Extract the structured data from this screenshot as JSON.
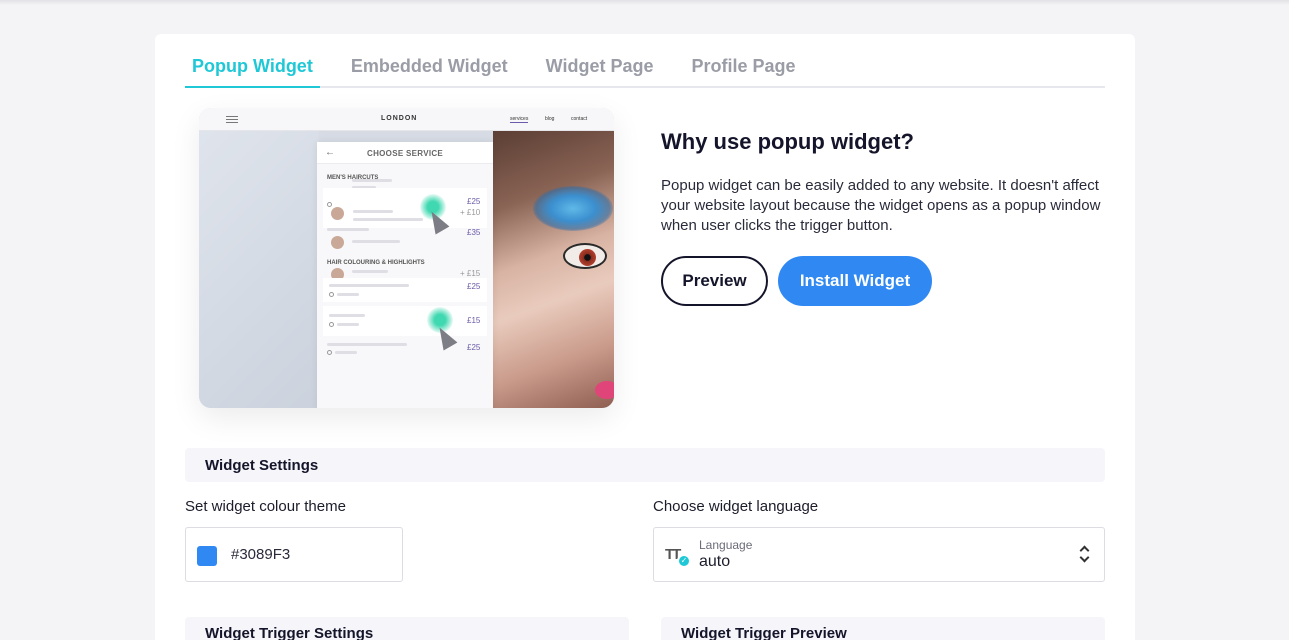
{
  "tabs": [
    "Popup Widget",
    "Embedded Widget",
    "Widget Page",
    "Profile Page"
  ],
  "preview": {
    "logo": "LONDON",
    "nav_links": [
      "services",
      "blog",
      "contact"
    ],
    "panel_title": "CHOOSE SERVICE",
    "sections": [
      "MEN'S HAIRCUTS",
      "HAIR COLOURING & HIGHLIGHTS"
    ],
    "prices": [
      "£25",
      "+ £10",
      "£35",
      "+ £15",
      "£25",
      "£15",
      "£25"
    ]
  },
  "info": {
    "title": "Why use popup widget?",
    "description": "Popup widget can be easily added to any website. It doesn't affect your website layout because the widget opens as a popup window when user clicks the trigger button.",
    "preview_label": "Preview",
    "install_label": "Install Widget"
  },
  "settings": {
    "section_title": "Widget Settings",
    "colour_label": "Set widget colour theme",
    "colour_value": "#3089F3",
    "language_label": "Choose widget language",
    "language_field_label": "Language",
    "language_value": "auto",
    "trigger_settings": "Widget Trigger Settings",
    "trigger_preview": "Widget Trigger Preview"
  },
  "colors": {
    "accent": "#1fc8d6",
    "primary": "#3089F3",
    "dark": "#14152a"
  },
  "icons": [
    "menu-icon",
    "back-arrow-icon",
    "language-icon",
    "check-icon",
    "select-arrows-icon"
  ]
}
